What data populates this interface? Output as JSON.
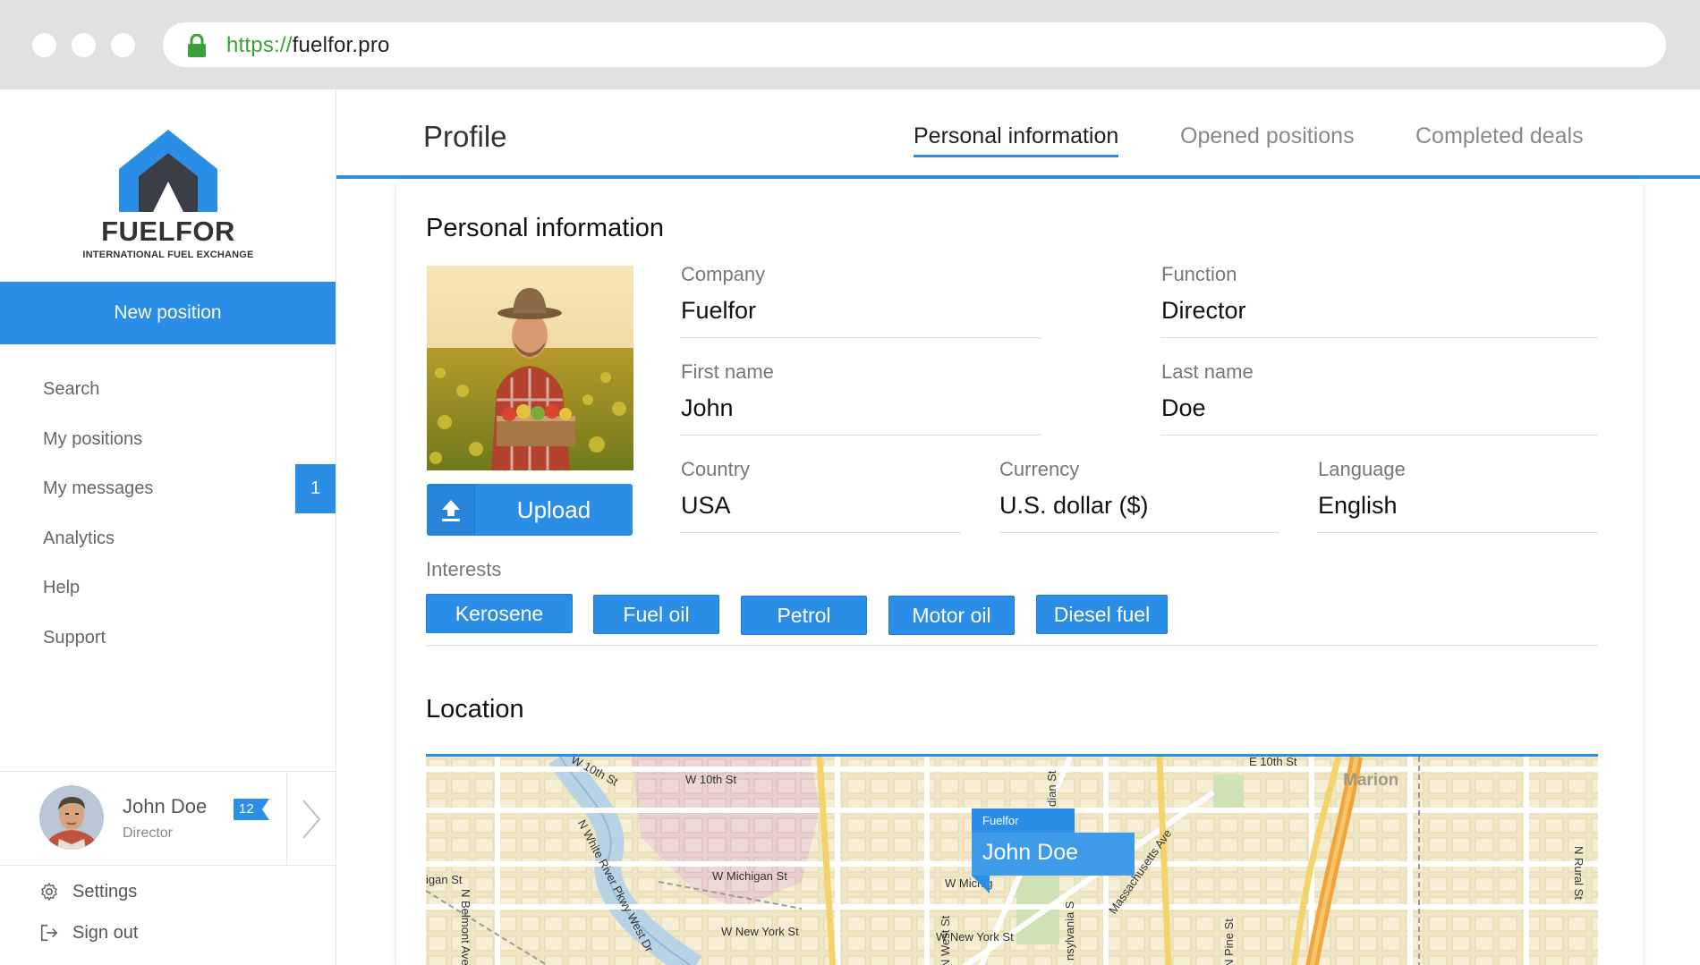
{
  "browser": {
    "url_protocol": "https://",
    "url_host": "fuelfor.pro"
  },
  "sidebar": {
    "logo_name": "FUELFOR",
    "logo_tagline": "INTERNATIONAL FUEL EXCHANGE",
    "new_position_label": "New position",
    "nav": [
      {
        "label": "Search"
      },
      {
        "label": "My positions"
      },
      {
        "label": "My messages",
        "badge": "1"
      },
      {
        "label": "Analytics"
      },
      {
        "label": "Help"
      },
      {
        "label": "Support"
      }
    ],
    "user": {
      "name": "John Doe",
      "role": "Director",
      "message_count": "12"
    },
    "settings_label": "Settings",
    "signout_label": "Sign out"
  },
  "header": {
    "title": "Profile",
    "tabs": [
      {
        "label": "Personal information",
        "active": true
      },
      {
        "label": "Opened positions",
        "active": false
      },
      {
        "label": "Completed deals",
        "active": false
      }
    ]
  },
  "profile": {
    "section_title": "Personal information",
    "upload_label": "Upload",
    "fields": {
      "company": {
        "label": "Company",
        "value": "Fuelfor"
      },
      "function": {
        "label": "Function",
        "value": "Director"
      },
      "first_name": {
        "label": "First name",
        "value": "John"
      },
      "last_name": {
        "label": "Last name",
        "value": "Doe"
      },
      "country": {
        "label": "Country",
        "value": "USA"
      },
      "currency": {
        "label": "Currency",
        "value": "U.S. dollar ($)"
      },
      "language": {
        "label": "Language",
        "value": "English"
      }
    },
    "interests_label": "Interests",
    "interests": [
      "Kerosene",
      "Fuel oil",
      "Petrol",
      "Motor oil",
      "Diesel fuel"
    ]
  },
  "location": {
    "section_title": "Location",
    "pin": {
      "tag": "Fuelfor",
      "name": "John Doe"
    },
    "street_labels": {
      "w10th_a": "W 10th St",
      "w10th_b": "W 10th St",
      "e10th": "E 10th St",
      "michigan_left": "igan St",
      "n_belmont": "N Belmont Ave",
      "white_river": "N White River Pkwy West Dr",
      "w_michigan": "W Michigan St",
      "w_michigan_2": "W Michig",
      "st_small": "St",
      "w_newyork": "W New York St",
      "w_newyork_2": "W New York St",
      "n_west": "N West St",
      "indiana": "dian St",
      "pennsylvania": "nsylvania S",
      "massachusetts": "Massachusetts Ave",
      "n_pine": "N Pine St",
      "n_rural": "N Rural St",
      "marion": "Marion"
    }
  },
  "colors": {
    "accent": "#2b8ee6",
    "chrome": "#e1e1e1",
    "secure_green": "#3aa13a"
  },
  "icons": [
    "lock-icon",
    "upload-icon",
    "chevron-right-icon",
    "gear-icon",
    "sign-out-icon",
    "fuelfor-logo"
  ]
}
